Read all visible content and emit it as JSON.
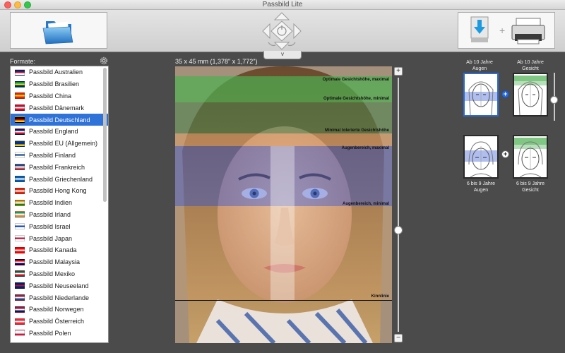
{
  "window": {
    "title": "Passbild Lite"
  },
  "toolbar": {
    "open_icon": "folder-icon",
    "nav_icon": "adjust-crosshair-icon",
    "nav_tab_label": "v",
    "print_icon": "download-print-icon"
  },
  "sidebar": {
    "label": "Formate:",
    "settings_icon": "gear-icon",
    "items": [
      {
        "label": "Passbild Australien",
        "flag": [
          "#012169",
          "#c8102e",
          "#ffffff"
        ]
      },
      {
        "label": "Passbild Brasilien",
        "flag": [
          "#009c3b",
          "#ffdf00",
          "#002776"
        ]
      },
      {
        "label": "Passbild China",
        "flag": [
          "#de2910",
          "#ffde00",
          "#de2910"
        ]
      },
      {
        "label": "Passbild Dänemark",
        "flag": [
          "#c8102e",
          "#ffffff",
          "#c8102e"
        ]
      },
      {
        "label": "Passbild Deutschland",
        "flag": [
          "#000000",
          "#dd0000",
          "#ffce00"
        ],
        "selected": true
      },
      {
        "label": "Passbild England",
        "flag": [
          "#012169",
          "#ffffff",
          "#c8102e"
        ]
      },
      {
        "label": "Passbild EU (Allgemein)",
        "flag": [
          "#003399",
          "#003399",
          "#ffcc00"
        ]
      },
      {
        "label": "Passbild Finland",
        "flag": [
          "#ffffff",
          "#003580",
          "#ffffff"
        ]
      },
      {
        "label": "Passbild Frankreich",
        "flag": [
          "#0055a4",
          "#ffffff",
          "#ef4135"
        ]
      },
      {
        "label": "Passbild Griechenland",
        "flag": [
          "#0d5eaf",
          "#ffffff",
          "#0d5eaf"
        ]
      },
      {
        "label": "Passbild Hong Kong",
        "flag": [
          "#de2910",
          "#ffffff",
          "#de2910"
        ]
      },
      {
        "label": "Passbild Indien",
        "flag": [
          "#ff9933",
          "#ffffff",
          "#138808"
        ]
      },
      {
        "label": "Passbild Irland",
        "flag": [
          "#169b62",
          "#ffffff",
          "#ff883e"
        ]
      },
      {
        "label": "Passbild Israel",
        "flag": [
          "#ffffff",
          "#0038b8",
          "#ffffff"
        ]
      },
      {
        "label": "Passbild Japan",
        "flag": [
          "#ffffff",
          "#bc002d",
          "#ffffff"
        ]
      },
      {
        "label": "Passbild Kanada",
        "flag": [
          "#ff0000",
          "#ffffff",
          "#ff0000"
        ]
      },
      {
        "label": "Passbild Malaysia",
        "flag": [
          "#cc0001",
          "#ffffff",
          "#010066"
        ]
      },
      {
        "label": "Passbild Mexiko",
        "flag": [
          "#006847",
          "#ffffff",
          "#ce1126"
        ]
      },
      {
        "label": "Passbild Neuseeland",
        "flag": [
          "#012169",
          "#c8102e",
          "#012169"
        ]
      },
      {
        "label": "Passbild Niederlande",
        "flag": [
          "#ae1c28",
          "#ffffff",
          "#21468b"
        ]
      },
      {
        "label": "Passbild Norwegen",
        "flag": [
          "#ba0c2f",
          "#ffffff",
          "#00205b"
        ]
      },
      {
        "label": "Passbild Österreich",
        "flag": [
          "#ed2939",
          "#ffffff",
          "#ed2939"
        ]
      },
      {
        "label": "Passbild Polen",
        "flag": [
          "#ffffff",
          "#ffffff",
          "#dc143c"
        ]
      }
    ]
  },
  "preview": {
    "dimensions": "35 x 45 mm (1,378\" x 1,772\")",
    "bands": [
      {
        "label": "Optimale Gesichtshöhe, maximal"
      },
      {
        "label": "Optimale Gesichtshöhe, minimal"
      },
      {
        "label": "Minimal tolerierte Gesichtshöhe"
      },
      {
        "label": "Augenbereich, maximal"
      },
      {
        "label": "Augenbereich, minimal"
      },
      {
        "label": "Kinnlinie"
      }
    ],
    "zoom_plus": "+",
    "zoom_minus": "−",
    "zoom_level": 0.4
  },
  "templates": {
    "adult_eyes": {
      "line1": "Ab 10 Jahre",
      "line2": "Augen"
    },
    "adult_face": {
      "line1": "Ab 10 Jahre",
      "line2": "Gesicht"
    },
    "child_eyes": {
      "line1": "6 bis 9 Jahre",
      "line2": "Augen"
    },
    "child_face": {
      "line1": "6 bis 9 Jahre",
      "line2": "Gesicht"
    },
    "plus": "+"
  },
  "colors": {
    "accent": "#2f72d8",
    "band_green": "#4caf50",
    "band_blue": "#5b72c9",
    "band_orange": "#e0a26b"
  }
}
